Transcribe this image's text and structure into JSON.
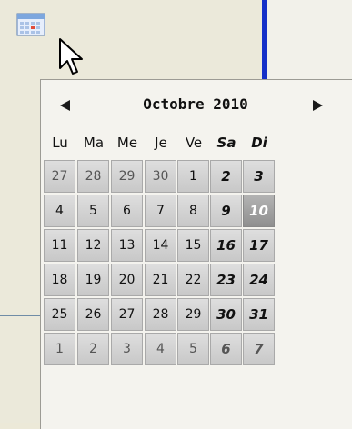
{
  "calendar": {
    "month_title": "Octobre 2010",
    "prev_icon": "triangle-left-icon",
    "next_icon": "triangle-right-icon",
    "weekdays": [
      "Lu",
      "Ma",
      "Me",
      "Je",
      "Ve",
      "Sa",
      "Di"
    ],
    "weeks": [
      [
        "27",
        "28",
        "29",
        "30",
        "1",
        "2",
        "3"
      ],
      [
        "4",
        "5",
        "6",
        "7",
        "8",
        "9",
        "10"
      ],
      [
        "11",
        "12",
        "13",
        "14",
        "15",
        "16",
        "17"
      ],
      [
        "18",
        "19",
        "20",
        "21",
        "22",
        "23",
        "24"
      ],
      [
        "25",
        "26",
        "27",
        "28",
        "29",
        "30",
        "31"
      ],
      [
        "1",
        "2",
        "3",
        "4",
        "5",
        "6",
        "7"
      ]
    ],
    "selected_day": "10"
  },
  "colors": {
    "accent_line": "#1530c8",
    "cell_bg": "#d4d4d4",
    "today_bg": "#a0a0a0"
  }
}
